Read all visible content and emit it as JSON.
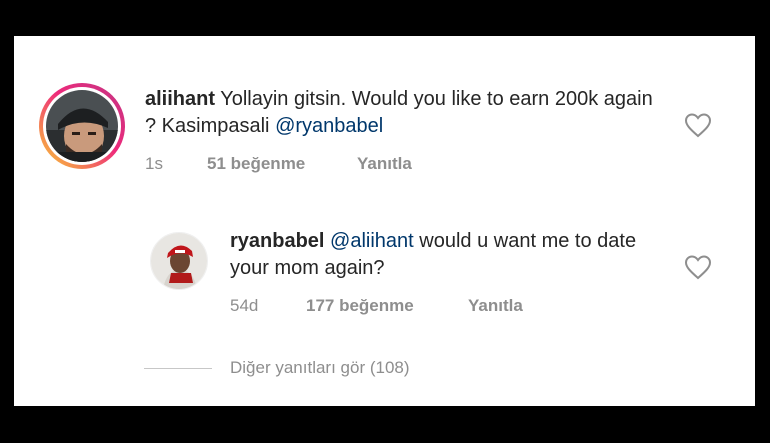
{
  "comment": {
    "username": "aliihant",
    "text_before_mention": " Yollayin gitsin. Would you like to earn 200k again ? Kasimpasali ",
    "mention": "@ryanbabel",
    "time": "1s",
    "likes": "51 beğenme",
    "reply_label": "Yanıtla",
    "avatar_icon": "profile-photo-man-beanie",
    "heart_icon": "heart-outline-icon"
  },
  "reply": {
    "username": "ryanbabel",
    "mention": "@aliihant",
    "text_after_mention": " would u want me to date your mom again?",
    "time": "54d",
    "likes": "177 beğenme",
    "reply_label": "Yanıtla",
    "avatar_icon": "profile-photo-man-red-cap",
    "heart_icon": "heart-outline-icon"
  },
  "view_replies": {
    "label": "Diğer yanıtları gör (108)"
  },
  "colors": {
    "text": "#262626",
    "meta": "#8e8e8e",
    "mention": "#00376b",
    "story_ring": [
      "#f9ce34",
      "#ee2a7b",
      "#c13584"
    ]
  }
}
